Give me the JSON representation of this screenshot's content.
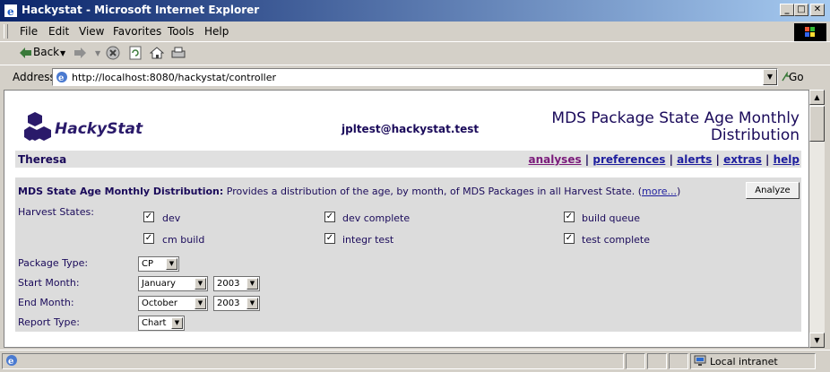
{
  "window": {
    "title": "Hackystat - Microsoft Internet Explorer",
    "minimize": "_",
    "maximize": "□",
    "close": "✕"
  },
  "menu": [
    "File",
    "Edit",
    "View",
    "Favorites",
    "Tools",
    "Help"
  ],
  "toolbar": {
    "back": "Back"
  },
  "address": {
    "label": "Address",
    "url": "http://localhost:8080/hackystat/controller",
    "go": "Go"
  },
  "status": {
    "zone": "Local intranet"
  },
  "page": {
    "logo_text": "HackyStat",
    "user_email": "jpltest@hackystat.test",
    "title": "MDS Package State Age Monthly Distribution",
    "username": "Theresa",
    "nav": [
      "analyses",
      "preferences",
      "alerts",
      "extras",
      "help"
    ],
    "nav_sep": "|",
    "desc_bold": "MDS State Age Monthly Distribution:",
    "desc_text": " Provides a distribution of the age, by month, of MDS Packages in all Harvest State. (",
    "more": "more...",
    "desc_close": ")",
    "analyze": "Analyze",
    "harvest_label": "Harvest States:",
    "states": [
      "dev",
      "dev complete",
      "build queue",
      "cm build",
      "integr test",
      "test complete"
    ],
    "check": "✓",
    "package_type_label": "Package Type:",
    "package_type": "CP",
    "start_month_label": "Start Month:",
    "start_month": "January",
    "start_year": "2003",
    "end_month_label": "End Month:",
    "end_month": "October",
    "end_year": "2003",
    "report_type_label": "Report Type:",
    "report_type": "Chart"
  },
  "colors": {
    "accent": "#1a0a5a",
    "link": "#1e1e9e",
    "titlebar": "#0a246a"
  }
}
